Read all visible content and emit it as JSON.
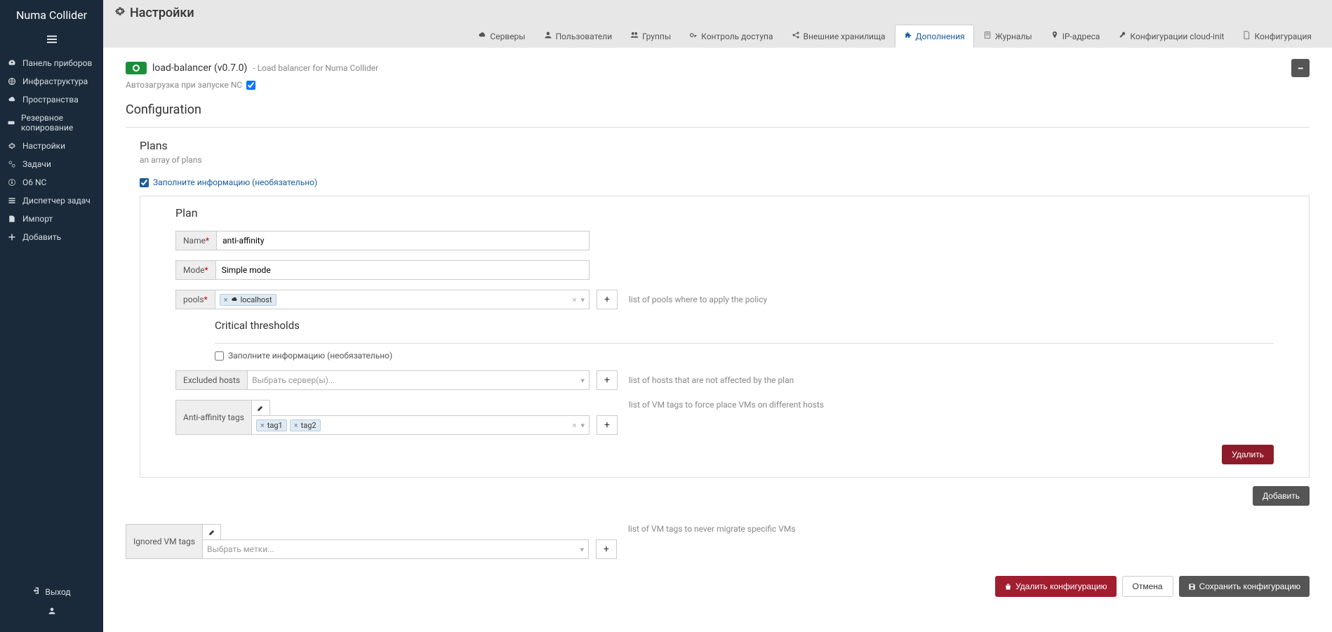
{
  "brand": "Numa Collider",
  "sidebar": {
    "items": [
      {
        "label": "Панель приборов"
      },
      {
        "label": "Инфраструктура"
      },
      {
        "label": "Пространства"
      },
      {
        "label": "Резервное копирование"
      },
      {
        "label": "Настройки"
      },
      {
        "label": "Задачи"
      },
      {
        "label": "О6 NC"
      },
      {
        "label": "Диспетчер задач"
      },
      {
        "label": "Импорт"
      },
      {
        "label": "Добавить"
      }
    ],
    "logout": "Выход"
  },
  "page_title": "Настройки",
  "tabs": [
    {
      "label": "Серверы"
    },
    {
      "label": "Пользователи"
    },
    {
      "label": "Группы"
    },
    {
      "label": "Контроль доступа"
    },
    {
      "label": "Внешние хранилища"
    },
    {
      "label": "Дополнения",
      "active": true
    },
    {
      "label": "Журналы"
    },
    {
      "label": "IP-адреса"
    },
    {
      "label": "Конфигурации cloud-init"
    },
    {
      "label": "Конфигурация"
    }
  ],
  "plugin": {
    "name": "load-balancer (v0.7.0)",
    "desc": "- Load balancer for Numa Collider",
    "autoload_label": "Автозагрузка при запуске NC",
    "autoload_checked": true
  },
  "config_title": "Configuration",
  "plans": {
    "title": "Plans",
    "subtitle": "an array of plans",
    "fill_info_label": "Заполните информацию (необязательно)",
    "fill_info_checked": true
  },
  "plan": {
    "title": "Plan",
    "name_label": "Name",
    "name_value": "anti-affinity",
    "mode_label": "Mode",
    "mode_value": "Simple mode",
    "pools_label": "pools",
    "pools_chips": [
      "localhost"
    ],
    "pools_help": "list of pools where to apply the policy",
    "critical_title": "Critical thresholds",
    "critical_fill_label": "Заполните информацию (необязательно)",
    "critical_fill_checked": false,
    "excluded_label": "Excluded hosts",
    "excluded_placeholder": "Выбрать сервер(ы)...",
    "excluded_help": "list of hosts that are not affected by the plan",
    "antiaffinity_label": "Anti-affinity tags",
    "antiaffinity_chips": [
      "tag1",
      "tag2"
    ],
    "antiaffinity_help": "list of VM tags to force place VMs on different hosts",
    "delete_btn": "Удалить"
  },
  "add_btn": "Добавить",
  "ignored": {
    "label": "Ignored VM tags",
    "placeholder": "Выбрать метки...",
    "help": "list of VM tags to never migrate specific VMs"
  },
  "footer": {
    "delete_config": "Удалить конфигурацию",
    "cancel": "Отмена",
    "save": "Сохранить конфигурацию"
  }
}
